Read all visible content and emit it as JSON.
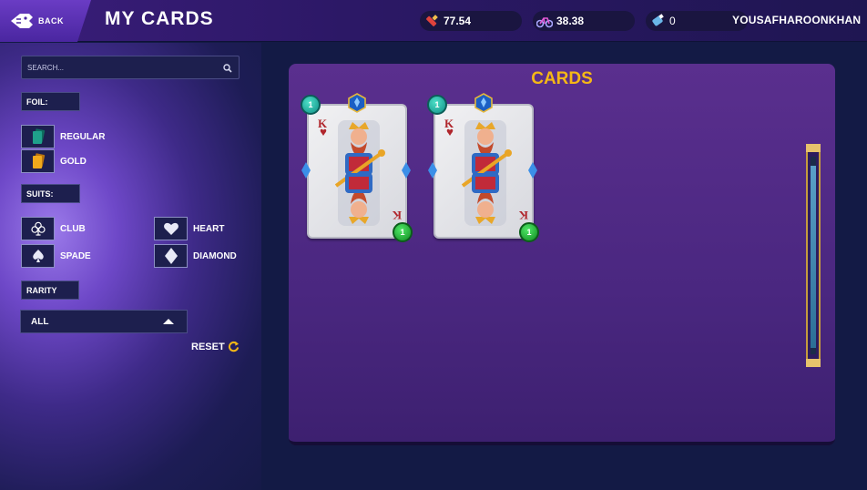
{
  "header": {
    "back_label": "BACK",
    "title": "MY CARDS",
    "stats": [
      {
        "icon": "crayon-icon",
        "value": "77.54"
      },
      {
        "icon": "bike-icon",
        "value": "38.38"
      },
      {
        "icon": "potion-icon",
        "value": "0"
      }
    ],
    "username": "YOUSAFHAROONKHAN"
  },
  "filters": {
    "search_placeholder": "SEARCH...",
    "foil_label": "FOIL:",
    "foil_options": [
      {
        "label": "REGULAR",
        "icon": "teal-cards-icon"
      },
      {
        "label": "GOLD",
        "icon": "gold-cards-icon"
      }
    ],
    "suits_label": "SUITS:",
    "suit_options": [
      {
        "label": "CLUB",
        "icon": "club-icon"
      },
      {
        "label": "HEART",
        "icon": "heart-icon"
      },
      {
        "label": "SPADE",
        "icon": "spade-icon"
      },
      {
        "label": "DIAMOND",
        "icon": "diamond-icon"
      }
    ],
    "rarity_label": "RARITY",
    "rarity_value": "ALL",
    "reset_label": "RESET"
  },
  "main": {
    "title": "CARDS",
    "cards": [
      {
        "rank": "K",
        "suit": "heart",
        "level_top": "1",
        "level_bottom": "1"
      },
      {
        "rank": "K",
        "suit": "heart",
        "level_top": "1",
        "level_bottom": "1"
      }
    ]
  },
  "colors": {
    "title_gold": "#f5b816",
    "panel_purple": "#4a2780",
    "background": "#131a45"
  }
}
